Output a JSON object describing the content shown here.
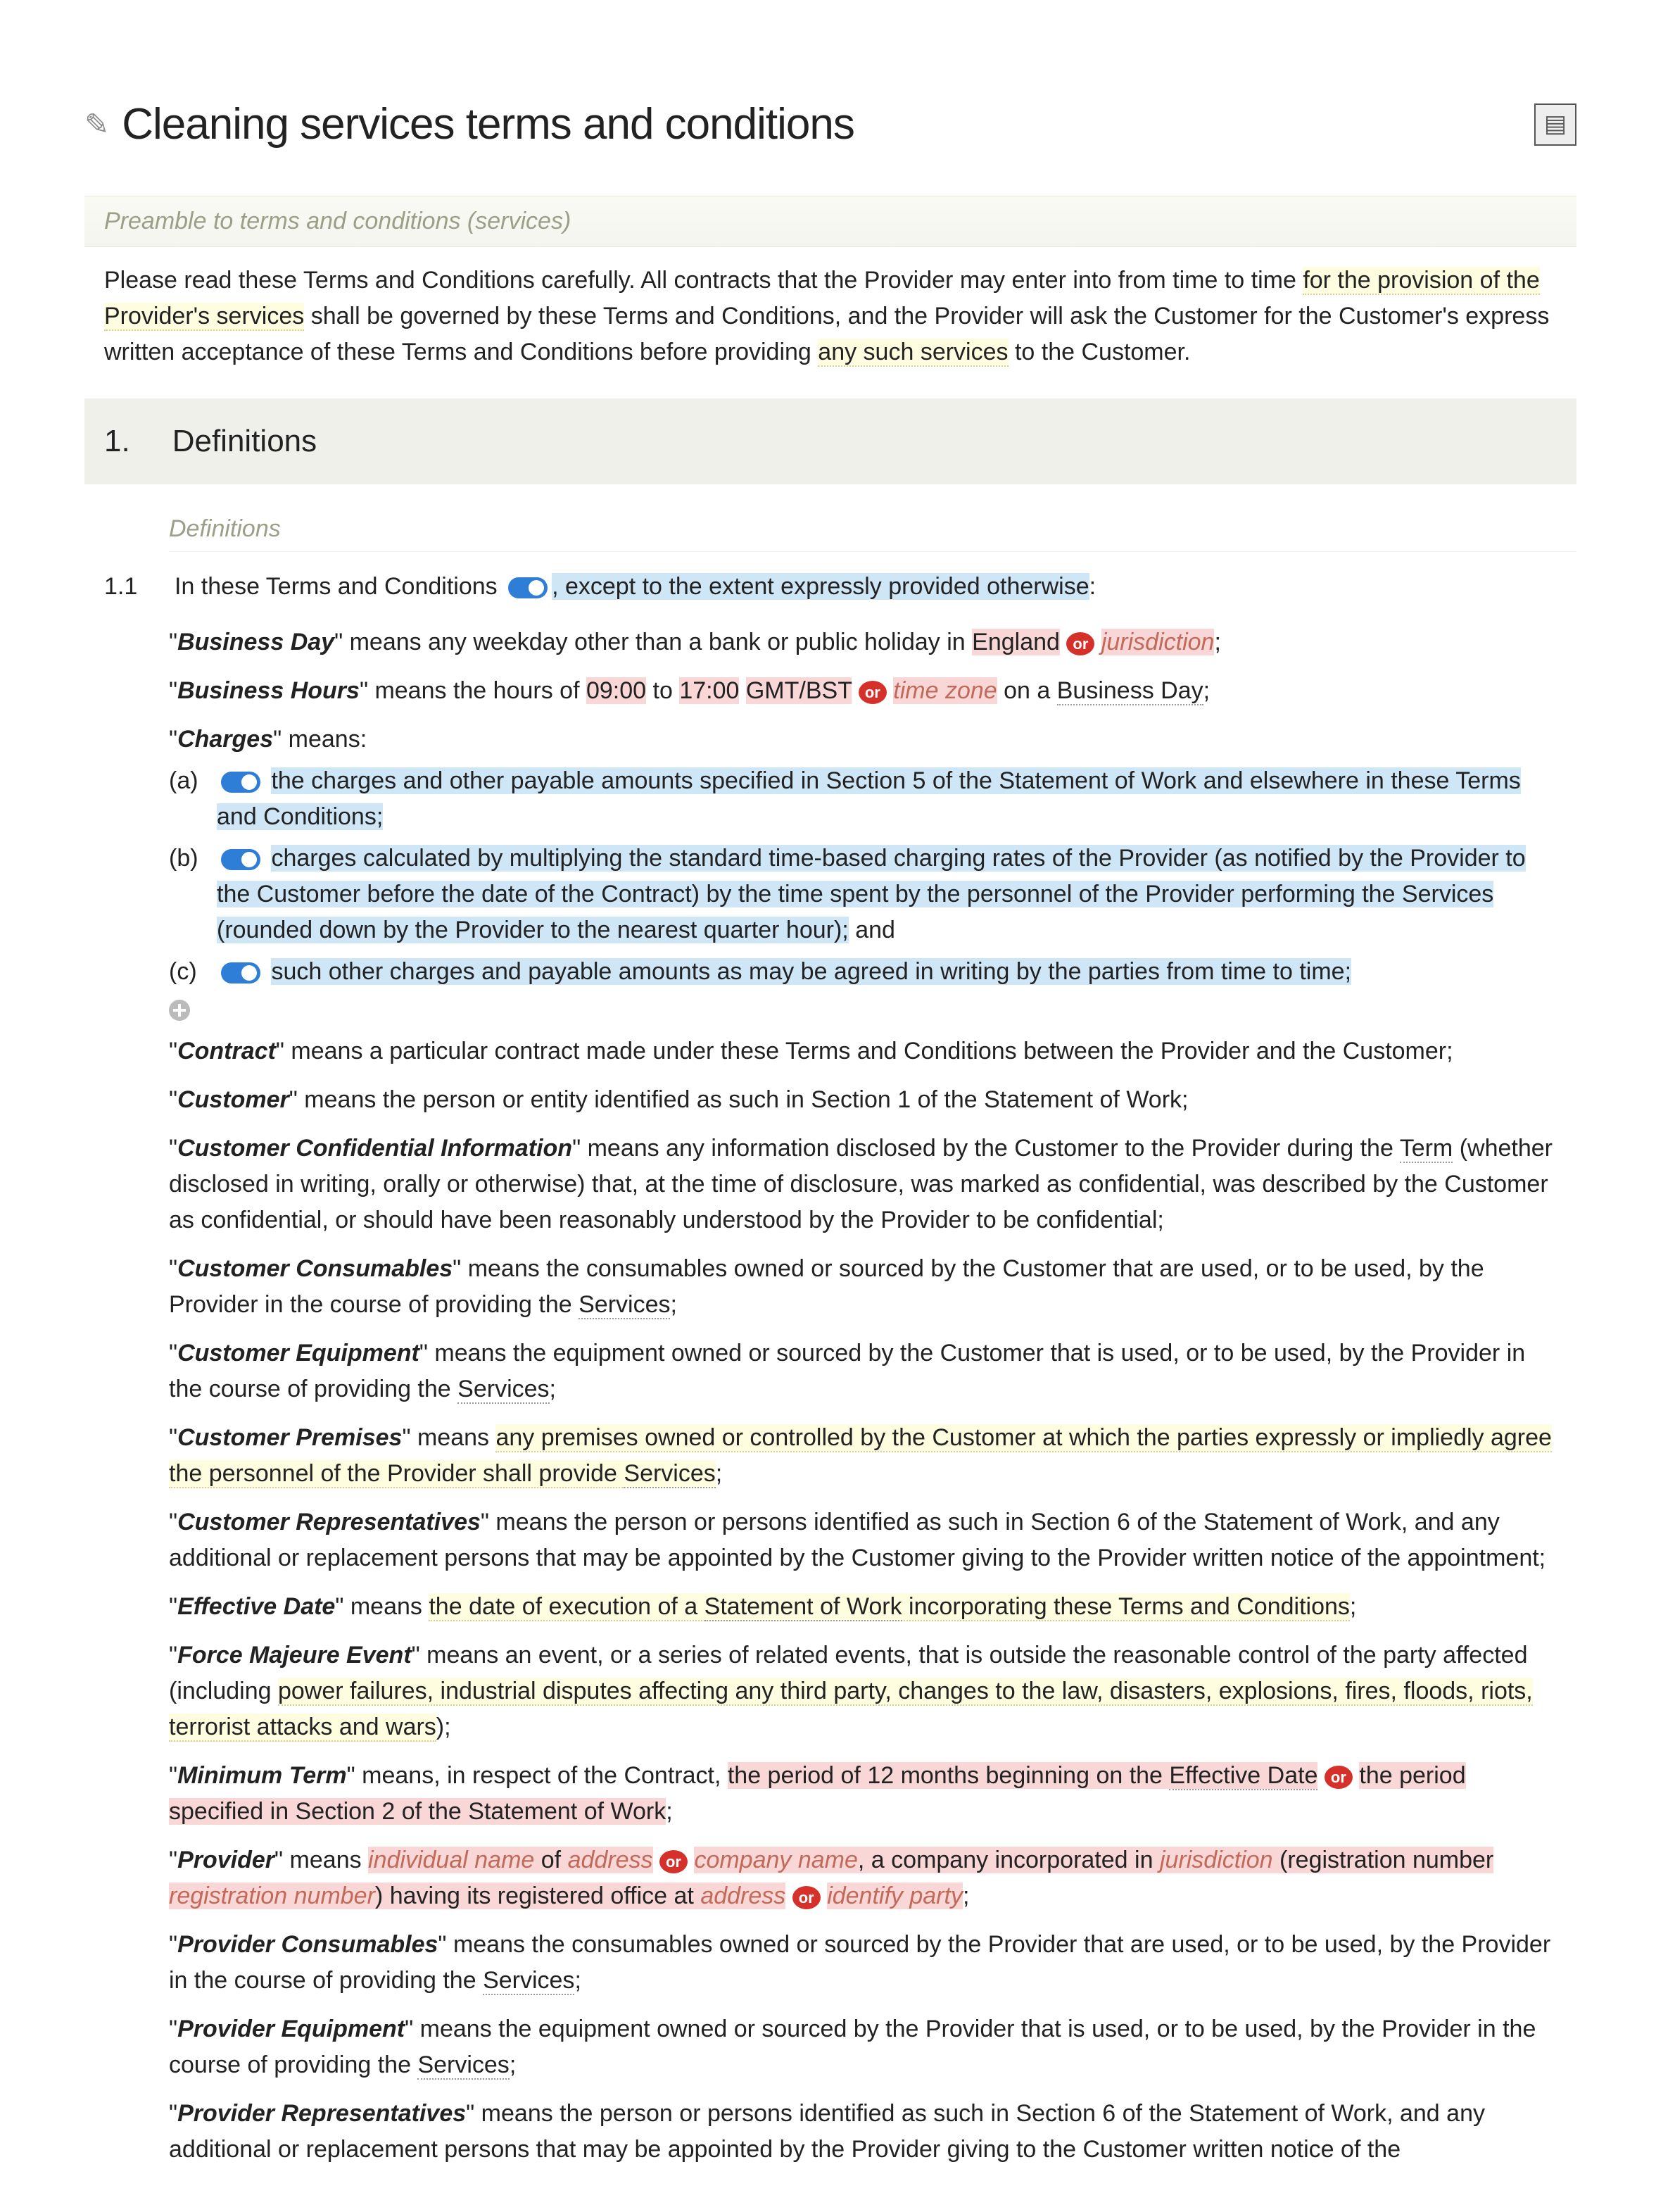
{
  "title": "Cleaning services terms and conditions",
  "preamble_title": "Preamble to terms and conditions (services)",
  "preamble_a": "Please read these Terms and Conditions carefully. All contracts that the Provider may enter into from time to time ",
  "preamble_h1": "for the provision of the Provider's services",
  "preamble_b": " shall be governed by these Terms and Conditions, and the Provider will ask the Customer for the Customer's express written acceptance of these Terms and Conditions before providing ",
  "preamble_h2": "any such services",
  "preamble_c": " to the Customer.",
  "section1_num": "1.",
  "section1_title": "Definitions",
  "def_label": "Definitions",
  "clause11_num": "1.1",
  "clause11_a": "In these Terms and Conditions",
  "clause11_b": ", except to the extent expressly provided otherwise",
  "clause11_c": ":",
  "bd_term": "Business Day",
  "bd_a": "\" means any weekday other than a bank or public holiday in ",
  "bd_england": "England",
  "bd_jur": "jurisdiction",
  "bh_term": "Business Hours",
  "bh_a": "\" means the hours of ",
  "bh_h1": "09:00",
  "bh_to": " to ",
  "bh_h2": "17:00",
  "bh_tz1": "GMT/BST",
  "bh_tz2": "time zone",
  "bh_on": " on a ",
  "bh_bd": "Business Day",
  "ch_term": "Charges",
  "ch_means": "\" means:",
  "ch_a_letter": "(a)",
  "ch_a_text": "the charges and other payable amounts specified in Section 5 of the Statement of Work and elsewhere in these Terms and Conditions;",
  "ch_b_letter": "(b)",
  "ch_b_text": "charges calculated by multiplying the standard time-based charging rates of the Provider (as notified by the Provider to the Customer before the date of the Contract) by the time spent by the personnel of the Provider performing the Services (rounded down by the Provider to the nearest quarter hour);",
  "ch_b_and": " and",
  "ch_c_letter": "(c)",
  "ch_c_text": "such other charges and payable amounts as may be agreed in writing by the parties from time to time;",
  "contract_term": "Contract",
  "contract_body": "\" means a particular contract made under these Terms and Conditions between the Provider and the Customer;",
  "cust_term": "Customer",
  "cust_body": "\" means the person or entity identified as such in Section 1 of the Statement of Work;",
  "cci_term": "Customer Confidential Information",
  "cci_a": "\" means any information disclosed by the Customer to the Provider during the ",
  "cci_term2": "Term",
  "cci_b": " (whether disclosed in writing, orally or otherwise) that, at the time of disclosure, was marked as confidential, was described by the Customer as confidential, or should have been reasonably understood by the Provider to be confidential;",
  "ccons_term": "Customer Consumables",
  "ccons_a": "\" means the consumables owned or sourced by the Customer that are used, or to be used, by the Provider in the course of providing the ",
  "services": "Services",
  "ceq_term": "Customer Equipment",
  "ceq_a": "\" means the equipment owned or sourced by the Customer that is used, or to be used, by the Provider in the course of providing the ",
  "cprem_term": "Customer Premises",
  "cprem_a": "\" means ",
  "cprem_h": "any premises owned or controlled by the Customer at which the parties expressly or impliedly agree the personnel of the Provider shall provide ",
  "crep_term": "Customer Representatives",
  "crep_body": "\" means the person or persons identified as such in Section 6 of the Statement of Work, and any additional or replacement persons that may be appointed by the Customer giving to the Provider written notice of the appointment;",
  "ed_term": "Effective Date",
  "ed_a": "\" means ",
  "ed_h": "the date of execution of a ",
  "ed_sow": "Statement of Work",
  "ed_c": " incorporating these Terms and Conditions",
  "fm_term": "Force Majeure Event",
  "fm_a": "\" means an event, or a series of related events, that is outside the reasonable control of the party affected (including ",
  "fm_h": "power failures, industrial disputes affecting any third party, changes to the law, disasters, explosions, fires, floods, riots, terrorist attacks and wars",
  "fm_c": ");",
  "mt_term": "Minimum Term",
  "mt_a": "\" means, in respect of the Contract, ",
  "mt_p1": "the period of 12 months beginning on the ",
  "mt_ed": "Effective Date",
  "mt_p2": "the period specified in Section 2 of the Statement of Work",
  "prov_term": "Provider",
  "prov_means": "\" means ",
  "prov_iname": "individual name",
  "prov_of": " of ",
  "prov_addr": "address",
  "prov_cname": "company name",
  "prov_inc": ", a company incorporated in ",
  "prov_jur": "jurisdiction",
  "prov_regopen": " (registration number ",
  "prov_regnum": "registration number",
  "prov_regclose": ") having its registered office at ",
  "prov_ident": "identify party",
  "pcons_term": "Provider Consumables",
  "pcons_a": "\" means the consumables owned or sourced by the Provider that are used, or to be used, by the Provider in the course of providing the ",
  "peq_term": "Provider Equipment",
  "peq_a": "\" means the equipment owned or sourced by the Provider that is used, or to be used, by the Provider in the course of providing the ",
  "prep_term": "Provider Representatives",
  "prep_body": "\" means the person or persons identified as such in Section 6 of the Statement of Work, and any additional or replacement persons that may be appointed by the Provider giving to the Customer written notice of the",
  "or": "or",
  "semi": ";"
}
